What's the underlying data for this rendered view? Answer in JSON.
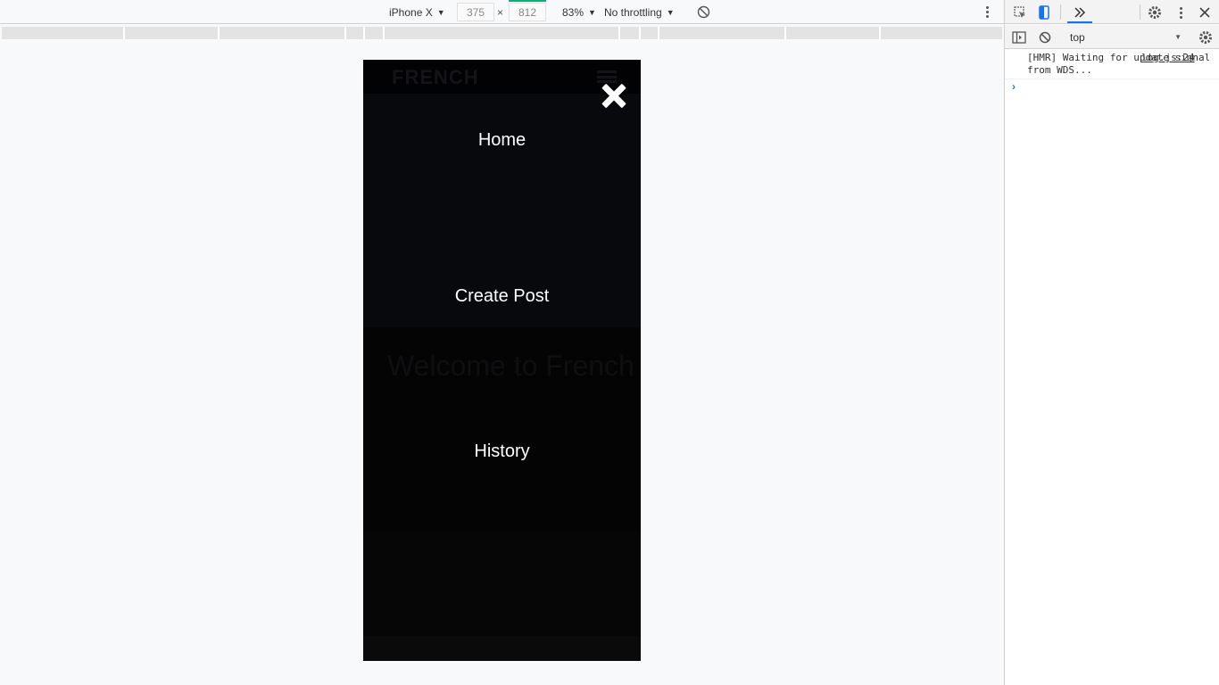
{
  "device_toolbar": {
    "device": "iPhone X",
    "width_value": "375",
    "height_value": "812",
    "times": "×",
    "zoom": "83%",
    "throttling": "No throttling",
    "accent_color": "#19a974"
  },
  "viewport": {
    "ghost_logo": "FRENCH",
    "ghost_welcome": "Welcome to French",
    "menu": {
      "items": [
        {
          "label": "Home"
        },
        {
          "label": "Create Post"
        },
        {
          "label": "History"
        }
      ],
      "close_icon": "close-icon",
      "overlay_color": "#050608"
    }
  },
  "devtools": {
    "context": "top",
    "console": {
      "message": "[HMR] Waiting for update signal from WDS...",
      "source": "log.js:24",
      "prompt": "›"
    },
    "icons": [
      "inspect-icon",
      "device-toggle-icon",
      "more-tabs-icon",
      "settings-icon",
      "more-icon",
      "close-icon",
      "sidebar-toggle-icon",
      "clear-console-icon",
      "console-settings-icon"
    ],
    "accent_color": "#1a73e8"
  }
}
